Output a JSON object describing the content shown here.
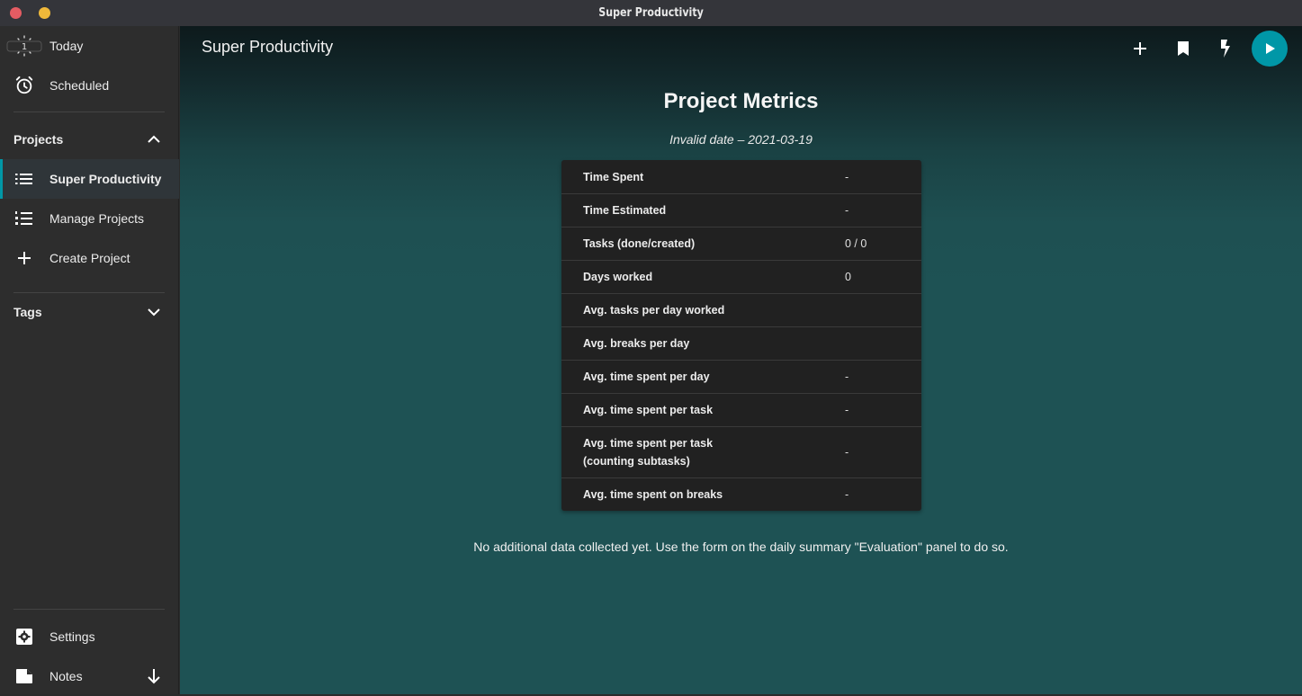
{
  "window": {
    "title": "Super Productivity"
  },
  "sidebar": {
    "top_items": [
      {
        "label": "Today",
        "icon": "today-calendar-icon",
        "badge": "1"
      },
      {
        "label": "Scheduled",
        "icon": "alarm-clock-icon"
      }
    ],
    "projects_section": {
      "label": "Projects",
      "expanded": true
    },
    "project_items": [
      {
        "label": "Super Productivity",
        "icon": "list-icon",
        "active": true
      },
      {
        "label": "Manage Projects",
        "icon": "numbered-list-icon"
      },
      {
        "label": "Create Project",
        "icon": "plus-icon"
      }
    ],
    "tags_section": {
      "label": "Tags",
      "expanded": false
    },
    "bottom_items": [
      {
        "label": "Settings",
        "icon": "settings-gear-icon"
      },
      {
        "label": "Notes",
        "icon": "note-icon",
        "trailing_icon": "arrow-down-icon"
      }
    ]
  },
  "topbar": {
    "title": "Super Productivity",
    "actions": [
      {
        "name": "add-task",
        "icon": "plus-icon"
      },
      {
        "name": "bookmarks",
        "icon": "bookmark-icon"
      },
      {
        "name": "quick-action",
        "icon": "flash-icon"
      },
      {
        "name": "start-tracking",
        "icon": "play-icon"
      }
    ],
    "accent_color": "#0097a7"
  },
  "main": {
    "title": "Project Metrics",
    "date_range": "Invalid date – 2021-03-19",
    "metrics": [
      {
        "label": "Time Spent",
        "value": "-"
      },
      {
        "label": "Time Estimated",
        "value": "-"
      },
      {
        "label": "Tasks (done/created)",
        "value": "0 / 0"
      },
      {
        "label": "Days worked",
        "value": "0"
      },
      {
        "label": "Avg. tasks per day worked",
        "value": ""
      },
      {
        "label": "Avg. breaks per day",
        "value": ""
      },
      {
        "label": "Avg. time spent per day",
        "value": "-"
      },
      {
        "label": "Avg. time spent per task",
        "value": "-"
      },
      {
        "label": "Avg. time spent per task (counting subtasks)",
        "label_line1": "Avg. time spent per task",
        "label_line2": "(counting subtasks)",
        "value": "-"
      },
      {
        "label": "Avg. time spent on breaks",
        "value": "-"
      }
    ],
    "note": "No additional data collected yet. Use the form on the daily summary \"Evaluation\" panel to do so."
  }
}
